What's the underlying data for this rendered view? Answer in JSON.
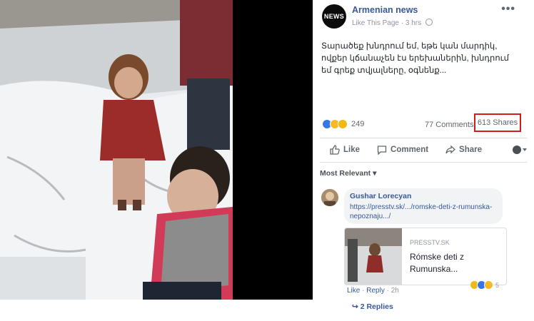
{
  "post": {
    "page_name": "Armenian news",
    "logo_text": "NEWS",
    "like_this_page": "Like This Page",
    "time": "3 hrs",
    "more": "•••",
    "text": "Տարածեք խնդրում եմ, եթե կան մարդիկ, ովքեր կճանաչեն էս երեխաներին, խնդրում եմ գրեք տվյալները, օգնենք...",
    "reaction_count": "249",
    "comments": "77 Comments",
    "shares": "613 Shares",
    "reaction_icons": [
      "like-icon",
      "wow-icon",
      "sad-icon"
    ]
  },
  "actions": {
    "like": "Like",
    "comment": "Comment",
    "share": "Share"
  },
  "sort": "Most Relevant ▾",
  "comment": {
    "author": "Gushar Lorecyan",
    "link": "https://presstv.sk/.../romske-deti-z-rumunska-nepoznaju.../",
    "preview_source": "PRESSTV.SK",
    "preview_title": "Rómske deti z Rumunska...",
    "like": "Like",
    "reply": "Reply",
    "time": "2h",
    "reaction_count": "5",
    "replies": "2 Replies"
  },
  "colors": {
    "link": "#385898",
    "highlight": "#d11a1a",
    "like_blue": "#3578e5"
  }
}
